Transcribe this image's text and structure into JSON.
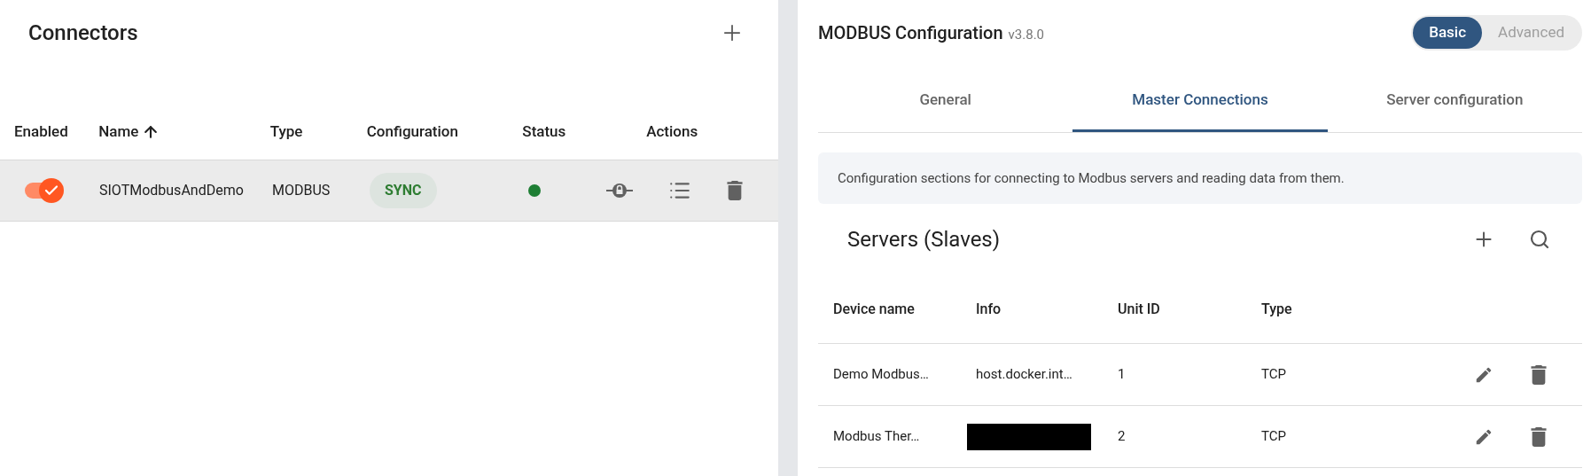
{
  "connectors": {
    "title": "Connectors",
    "columns": [
      "Enabled",
      "Name",
      "Type",
      "Configuration",
      "Status",
      "Actions"
    ],
    "rows": [
      {
        "enabled": true,
        "name": "SIOTModbusAndDemo",
        "type": "MODBUS",
        "configuration": "SYNC",
        "color": "#1e7e34"
      }
    ]
  },
  "config": {
    "title": "MODBUS Configuration",
    "version": "v3.8.0",
    "modes": [
      {
        "label": "Basic",
        "selected": true
      },
      {
        "label": "Advanced",
        "selected": false
      }
    ],
    "tabs": [
      {
        "label": "General",
        "selected": false
      },
      {
        "label": "Master Connections",
        "selected": true
      },
      {
        "label": "Server configuration",
        "selected": false
      }
    ],
    "info": "Configuration sections for connecting to Modbus servers and reading data from them.",
    "servers": {
      "title": "Servers (Slaves)",
      "columns": [
        "Device name",
        "Info",
        "Unit ID",
        "Type"
      ],
      "rows": [
        {
          "device_name": "Demo Modbus…",
          "info": "host.docker.int…",
          "info_redacted": false,
          "unit_id": "1",
          "type": "TCP"
        },
        {
          "device_name": "Modbus Ther…",
          "info_redacted": true,
          "unit_id": "2",
          "type": "TCP"
        }
      ]
    }
  }
}
